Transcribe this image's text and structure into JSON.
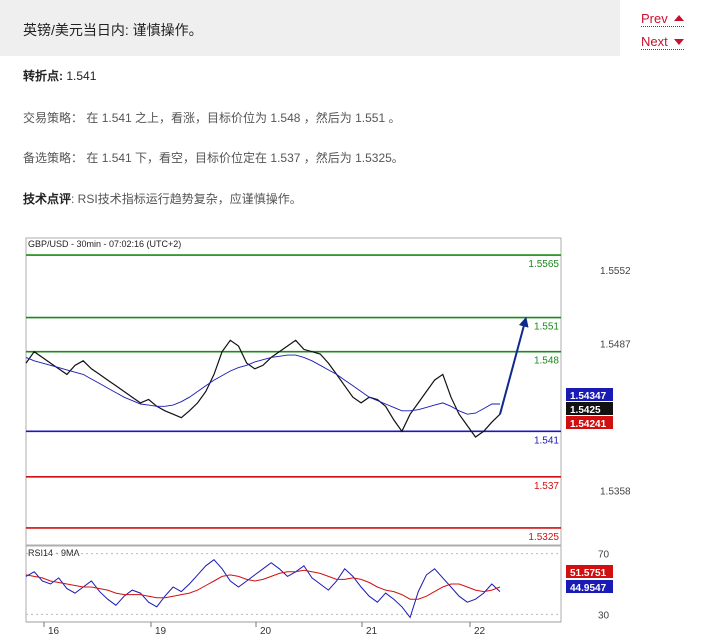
{
  "header": {
    "title": "英镑/美元当日内: 谨慎操作。",
    "prev_label": "Prev",
    "next_label": "Next"
  },
  "analysis": {
    "pivot_label": "转折点:",
    "pivot_value": "1.541",
    "strategy_label": "交易策略：",
    "strategy_text": "在 1.541 之上，看涨，目标价位为 1.548 ，然后为 1.551 。",
    "alt_label": "备选策略：",
    "alt_text": "在 1.541 下，看空，目标价位定在 1.537 ，然后为 1.5325。",
    "tech_label": "技术点评",
    "tech_text": ": RSI技术指标运行趋势复杂，应谨慎操作。"
  },
  "chart_data": [
    {
      "type": "line",
      "title": "GBP/USD - 30min - 07:02:16 (UTC+2)",
      "ylim": [
        1.531,
        1.558
      ],
      "y_ticks": [
        "1.5552",
        "1.5487",
        "1.5358"
      ],
      "x_ticks": [
        "16",
        "19",
        "20",
        "21",
        "22"
      ],
      "levels": [
        {
          "label": "1.5565",
          "value": 1.5565,
          "color": "#1a8a1a"
        },
        {
          "label": "1.551",
          "value": 1.551,
          "color": "#1a8a1a"
        },
        {
          "label": "1.548",
          "value": 1.548,
          "color": "#1a8a1a"
        },
        {
          "label": "1.541",
          "value": 1.541,
          "color": "#1a1ab5"
        },
        {
          "label": "1.537",
          "value": 1.537,
          "color": "#d01010"
        },
        {
          "label": "1.5325",
          "value": 1.5325,
          "color": "#d01010"
        }
      ],
      "price_tags": [
        {
          "label": "1.54347",
          "color": "#1a1ab5"
        },
        {
          "label": "1.5425",
          "color": "#111111"
        },
        {
          "label": "1.54241",
          "color": "#d01010"
        }
      ],
      "series": [
        {
          "values": [
            1.547,
            1.548,
            1.5475,
            1.547,
            1.5465,
            1.546,
            1.5468,
            1.5472,
            1.5465,
            1.546,
            1.5455,
            1.545,
            1.5445,
            1.544,
            1.5435,
            1.5438,
            1.5432,
            1.5428,
            1.5425,
            1.5422,
            1.5428,
            1.5435,
            1.5445,
            1.546,
            1.548,
            1.549,
            1.5485,
            1.547,
            1.5465,
            1.5468,
            1.5475,
            1.548,
            1.5485,
            1.549,
            1.5482,
            1.548,
            1.5478,
            1.547,
            1.546,
            1.545,
            1.544,
            1.5435,
            1.544,
            1.5438,
            1.5432,
            1.542,
            1.541,
            1.5425,
            1.5435,
            1.5445,
            1.5455,
            1.546,
            1.544,
            1.5425,
            1.5415,
            1.5405,
            1.541,
            1.5418,
            1.5425
          ]
        },
        {
          "values": [
            1.5475,
            1.5472,
            1.547,
            1.5468,
            1.5466,
            1.5464,
            1.5462,
            1.546,
            1.5456,
            1.5452,
            1.5448,
            1.5444,
            1.544,
            1.5437,
            1.5434,
            1.5433,
            1.5432,
            1.5432,
            1.5433,
            1.5436,
            1.544,
            1.5445,
            1.545,
            1.5455,
            1.5459,
            1.5463,
            1.5466,
            1.5468,
            1.5471,
            1.5473,
            1.5475,
            1.5476,
            1.5477,
            1.5477,
            1.5475,
            1.5472,
            1.5468,
            1.5464,
            1.546,
            1.5455,
            1.545,
            1.5445,
            1.544,
            1.5437,
            1.5434,
            1.5431,
            1.5428,
            1.5428,
            1.5429,
            1.5431,
            1.5433,
            1.5435,
            1.5432,
            1.5428,
            1.5425,
            1.5426,
            1.543,
            1.5434,
            1.5434
          ]
        }
      ],
      "projection": {
        "from": 1.5425,
        "to": 1.551
      }
    },
    {
      "type": "line",
      "title": "RSI14 - 9MA",
      "ylim": [
        25,
        75
      ],
      "y_ticks": [
        "70",
        "30"
      ],
      "value_tags": [
        {
          "label": "51.5751",
          "color": "#d01010"
        },
        {
          "label": "44.9547",
          "color": "#1a1ab5"
        }
      ],
      "series": [
        {
          "values": [
            55,
            58,
            52,
            50,
            54,
            47,
            44,
            48,
            52,
            45,
            40,
            36,
            42,
            46,
            44,
            38,
            35,
            42,
            48,
            45,
            50,
            56,
            62,
            66,
            60,
            52,
            48,
            52,
            56,
            60,
            64,
            60,
            55,
            58,
            62,
            54,
            50,
            46,
            52,
            60,
            55,
            48,
            42,
            38,
            44,
            40,
            35,
            28,
            45,
            56,
            60,
            54,
            48,
            42,
            38,
            40,
            44,
            50,
            45
          ]
        },
        {
          "values": [
            56,
            55,
            54,
            52,
            51,
            50,
            49,
            48,
            48,
            47,
            46,
            44,
            43,
            43,
            43,
            42,
            41,
            41,
            42,
            43,
            44,
            46,
            49,
            52,
            55,
            56,
            55,
            53,
            52,
            53,
            55,
            57,
            58,
            58,
            59,
            58,
            57,
            55,
            53,
            53,
            54,
            53,
            51,
            48,
            46,
            45,
            43,
            40,
            40,
            42,
            45,
            48,
            50,
            50,
            48,
            46,
            45,
            46,
            48
          ]
        }
      ]
    }
  ]
}
